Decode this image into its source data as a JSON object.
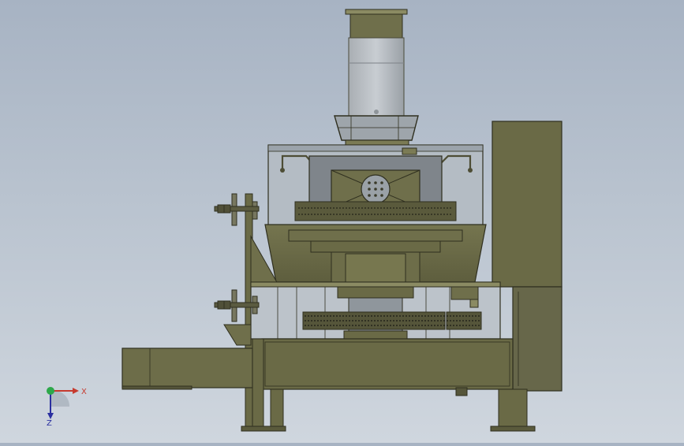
{
  "viewport": {
    "background_top": "#a7b3c3",
    "background_bottom": "#cfd6de",
    "model_color": "#6b6b47",
    "model_edge": "#2f2f1f",
    "glass_color": "#b8c0c8"
  },
  "triad": {
    "x_label": "X",
    "z_label": "Z",
    "x_color": "#c63a2e",
    "y_color": "#2da84a",
    "z_color": "#2a2fa0"
  }
}
